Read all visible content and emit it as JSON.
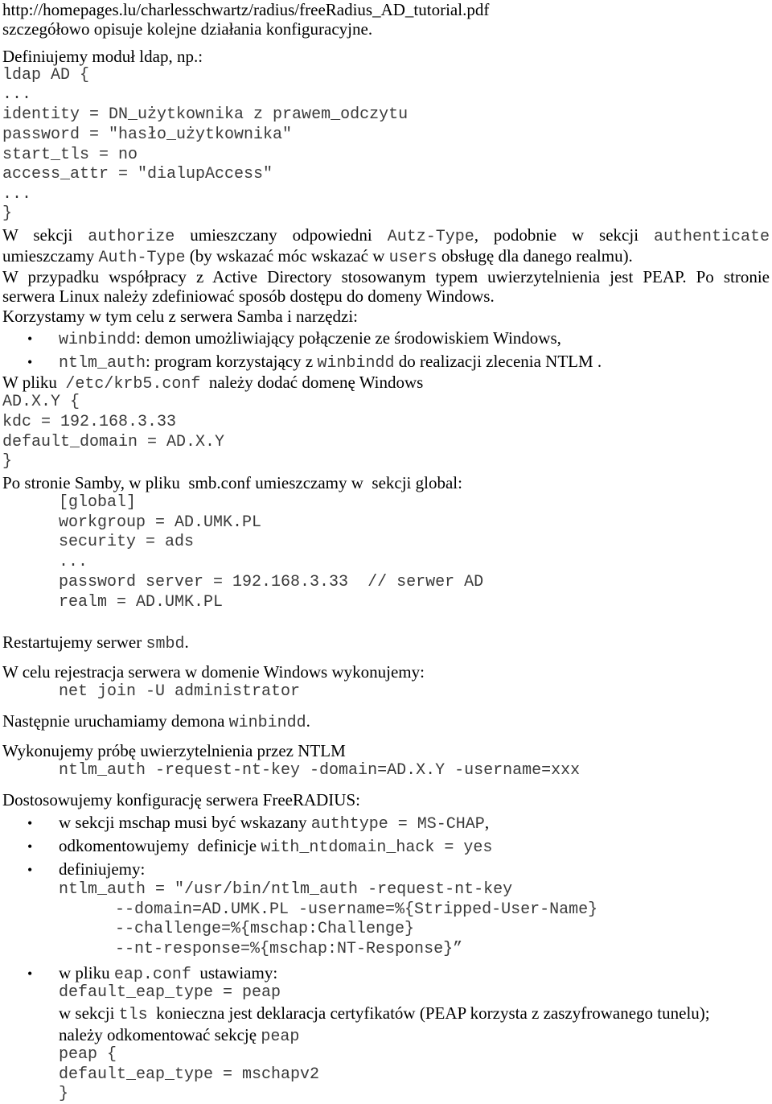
{
  "doc": {
    "p1": {
      "l1": "http://homepages.lu/charlesschwartz/radius/freeRadius_AD_tutorial.pdf",
      "l2": "szczegółowo opisuje kolejne działania konfiguracyjne."
    },
    "p2": "Definiujemy moduł ldap, np.:",
    "ldap_code": [
      "ldap AD {",
      "...",
      "identity = DN_użytkownika z prawem_odczytu",
      "password = \"hasło_użytkownika\"",
      "start_tls = no",
      "access_attr = \"dialupAccess\"",
      "...",
      "}"
    ],
    "p3": {
      "a": "W sekcji ",
      "b": "authorize",
      "c": " umieszczany odpowiedni ",
      "d": "Autz-Type",
      "e": ", podobnie w sekcji ",
      "f": "authenticate",
      "g": "umieszczamy ",
      "h": "Auth-Type",
      "i": " (by wskazać móc wskazać w ",
      "j": "users",
      "k": " obsługę dla danego realmu)."
    },
    "p4": {
      "l1": "W przypadku współpracy z Active Directory stosowanym typem uwierzytelnienia jest PEAP. Po stronie",
      "l2": "serwera Linux należy zdefiniować sposób dostępu do domeny Windows."
    },
    "p5": "Korzystamy w tym celu z serwera Samba i narzędzi:",
    "bullets1": [
      {
        "code": "winbindd",
        "text": ": demon umożliwiający połączenie ze środowiskiem Windows,"
      },
      {
        "code": "ntlm_auth",
        "text": ": program korzystający z ",
        "code2": "winbindd",
        "text2": " do realizacji zlecenia NTLM ."
      }
    ],
    "p6": {
      "a": "W pliku  ",
      "b": "/etc/krb5.conf",
      "c": "  należy dodać domenę Windows"
    },
    "krb_code": [
      "AD.X.Y {",
      "kdc = 192.168.3.33",
      "default_domain = AD.X.Y",
      "}"
    ],
    "p7": "Po stronie Samby, w pliku  smb.conf umieszczamy w  sekcji global:",
    "smb_code": [
      "[global]",
      "workgroup = AD.UMK.PL",
      "security = ads",
      "...",
      "password server = 192.168.3.33  // serwer AD",
      "realm = AD.UMK.PL"
    ],
    "p8": {
      "a": "Restartujemy serwer ",
      "b": "smbd",
      "c": "."
    },
    "p9": "W celu rejestracja serwera w domenie Windows wykonujemy:",
    "net_code": "net join -U administrator",
    "p10": {
      "a": "Następnie uruchamiamy demona ",
      "b": "winbindd",
      "c": "."
    },
    "p11": "Wykonujemy próbę uwierzytelnienia przez NTLM",
    "ntlm_code": "ntlm_auth -request-nt-key -domain=AD.X.Y -username=xxx",
    "p12": "Dostosowujemy konfigurację serwera FreeRADIUS:",
    "bullets2": {
      "b1": {
        "text": "w sekcji mschap musi być wskazany ",
        "code": "authtype = MS-CHAP",
        "tail": ","
      },
      "b2": {
        "text": "odkomentowujemy  definicje ",
        "code": "with_ntdomain_hack = yes"
      },
      "b3": {
        "text": "definiujemy:"
      },
      "b3_code": [
        "ntlm_auth = \"/usr/bin/ntlm_auth -request-nt-key",
        "--domain=AD.UMK.PL -username=%{Stripped-User-Name}",
        "--challenge=%{mschap:Challenge}",
        "--nt-response=%{mschap:NT-Response}”"
      ],
      "b4": {
        "text": "w pliku ",
        "code": "eap.conf",
        "tail": "  ustawiamy:"
      },
      "b4_lines": {
        "c1": "default_eap_type = peap",
        "t1a": "w sekcji ",
        "t1b": "tls",
        "t1c": "  konieczna jest deklaracja certyfikatów (PEAP korzysta z zaszyfrowanego tunelu);",
        "t2a": "należy odkomentować sekcję ",
        "t2b": "peap",
        "c2": "peap {",
        "c3": "default_eap_type = mschapv2",
        "c4": "}"
      }
    },
    "bullet_glyph": "•"
  }
}
